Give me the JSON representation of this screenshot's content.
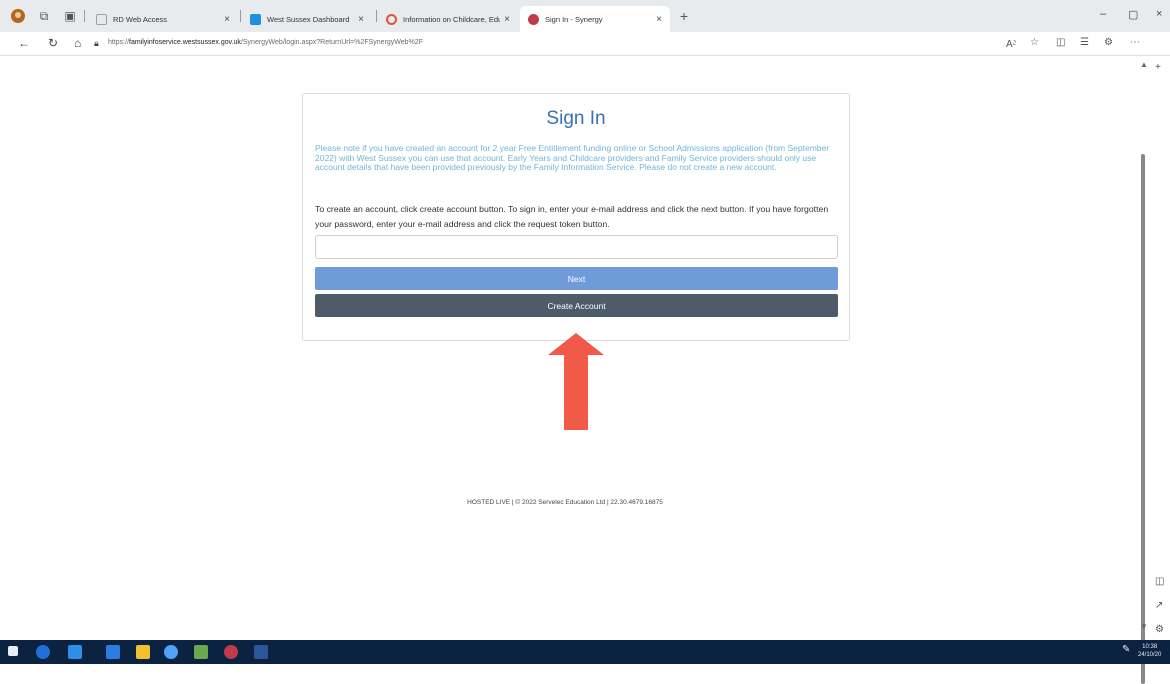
{
  "browser": {
    "tabs": [
      {
        "label": "RD Web Access",
        "favicon_color": "#9aa0a6"
      },
      {
        "label": "West Sussex Dashboard",
        "favicon_color": "#1f8fe0"
      },
      {
        "label": "Information on Childcare, Educa",
        "favicon_color": "#e0553a"
      },
      {
        "label": "Sign In - Synergy",
        "favicon_color": "#c23b4b",
        "active": true
      }
    ],
    "tab_close": "×",
    "new_tab": "+",
    "url_prefix": "https://",
    "url_host": "familyinfoservice.westsussex.gov.uk",
    "url_path": "/SynergyWeb/login.aspx?ReturnUrl=%2FSynergyWeb%2F",
    "window_controls": [
      "–",
      "▢",
      "×"
    ],
    "nav": {
      "back": "←",
      "refresh": "↻",
      "home": "⌂"
    },
    "addr_right_icons": [
      "A⁲",
      "☆",
      "◫",
      "☰",
      "⚙",
      "⋯"
    ]
  },
  "page": {
    "title": "Sign In",
    "notice": "Please note if you have created an account for 2 year Free Entitlement funding online or School Admissions application (from September 2022) with West Sussex you can use that account. Early Years and Childcare providers and Family Service providers should only use account details that have been provided previously by the Family Information Service. Please do not create a new account.",
    "info": "To create an account, click create account button. To sign in, enter your e-mail address and click the next button. If you have forgotten your password, enter your e-mail address and click the request token button.",
    "email_value": "",
    "next_label": "Next",
    "create_label": "Create Account",
    "footer": "HOSTED LIVE | © 2022 Servelec Education Ltd | 22.30.4679.16875"
  },
  "annotation": {
    "arrow_color": "#f15a48"
  },
  "taskbar": {
    "time": "10:38",
    "date": "24/10/20",
    "app_colors": [
      "#1f6fd6",
      "#2e8ee8",
      "#2a7de1",
      "#f2c12e",
      "#4fa3f7",
      "#6aa84f",
      "#c23b4b",
      "#2b579a"
    ]
  }
}
